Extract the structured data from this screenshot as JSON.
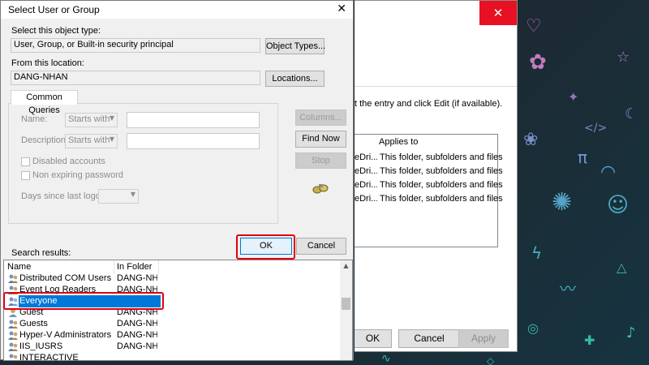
{
  "dialog": {
    "title": "Select User or Group",
    "close_glyph": "✕",
    "object_type_label": "Select this object type:",
    "object_type_value": "User, Group, or Built-in security principal",
    "object_types_button": "Object Types...",
    "location_label": "From this location:",
    "location_value": "DANG-NHAN",
    "locations_button": "Locations...",
    "tab_label": "Common Queries",
    "queries": {
      "name_label": "Name:",
      "name_mode": "Starts with",
      "description_label": "Description:",
      "description_mode": "Starts with",
      "disabled_accounts": "Disabled accounts",
      "non_expiring": "Non expiring password",
      "days_since_logon": "Days since last logon:",
      "columns_button": "Columns...",
      "find_now_button": "Find Now",
      "stop_button": "Stop",
      "search_icon": "search-binoculars-icon"
    },
    "ok_button": "OK",
    "cancel_button": "Cancel",
    "search_results_label": "Search results:",
    "results": {
      "columns": [
        "Name",
        "In Folder"
      ],
      "rows": [
        {
          "name": "Distributed COM Users",
          "folder": "DANG-NH..."
        },
        {
          "name": "Event Log Readers",
          "folder": "DANG-NH..."
        },
        {
          "name": "Everyone",
          "folder": "",
          "selected": true
        },
        {
          "name": "Guest",
          "folder": "DANG-NH..."
        },
        {
          "name": "Guests",
          "folder": "DANG-NH..."
        },
        {
          "name": "Hyper-V Administrators",
          "folder": "DANG-NH..."
        },
        {
          "name": "IIS_IUSRS",
          "folder": "DANG-NH..."
        },
        {
          "name": "INTERACTIVE",
          "folder": ""
        }
      ]
    }
  },
  "background_window": {
    "close_glyph": "✕",
    "instruction": "t the entry and click Edit (if available).",
    "table_header": [
      "",
      "Applies to"
    ],
    "rows": [
      {
        "col1": "eDri...",
        "applies": "This folder, subfolders and files"
      },
      {
        "col1": "eDri...",
        "applies": "This folder, subfolders and files"
      },
      {
        "col1": "eDri...",
        "applies": "This folder, subfolders and files"
      },
      {
        "col1": "eDri...",
        "applies": "This folder, subfolders and files"
      }
    ],
    "ok_button": "OK",
    "cancel_button": "Cancel",
    "apply_button": "Apply"
  },
  "colors": {
    "selection": "#0078d7",
    "highlight_box": "#e0000e",
    "close_button_bg": "#e81123",
    "dialog_bg": "#f0f0f0"
  }
}
